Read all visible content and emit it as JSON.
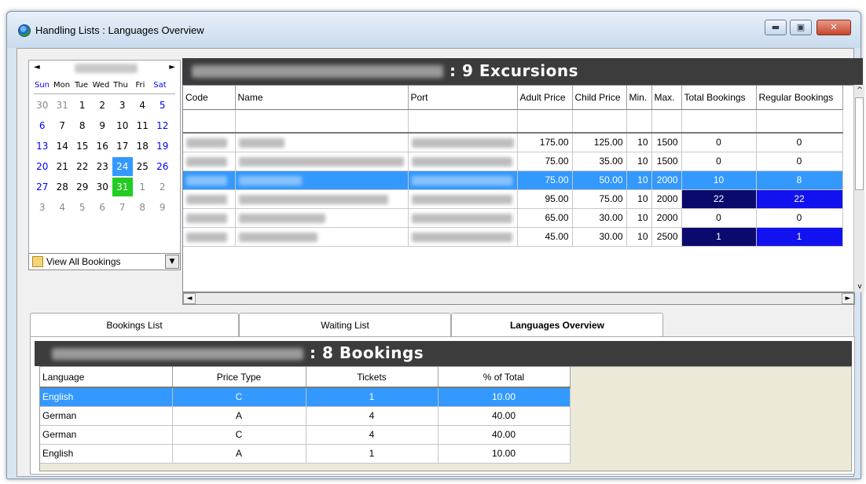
{
  "window": {
    "title": "Handling Lists : Languages Overview",
    "min_symbol": "▬",
    "max_symbol": "▣",
    "close_symbol": "✕"
  },
  "calendar": {
    "prev_symbol": "◄",
    "next_symbol": "►",
    "days_of_week": [
      "Sun",
      "Mon",
      "Tue",
      "Wed",
      "Thu",
      "Fri",
      "Sat"
    ],
    "weeks": [
      [
        {
          "d": "30",
          "k": "other"
        },
        {
          "d": "31",
          "k": "other"
        },
        {
          "d": "1",
          "k": ""
        },
        {
          "d": "2",
          "k": ""
        },
        {
          "d": "3",
          "k": ""
        },
        {
          "d": "4",
          "k": ""
        },
        {
          "d": "5",
          "k": "weekend"
        }
      ],
      [
        {
          "d": "6",
          "k": "weekend"
        },
        {
          "d": "7",
          "k": ""
        },
        {
          "d": "8",
          "k": ""
        },
        {
          "d": "9",
          "k": ""
        },
        {
          "d": "10",
          "k": ""
        },
        {
          "d": "11",
          "k": ""
        },
        {
          "d": "12",
          "k": "weekend"
        }
      ],
      [
        {
          "d": "13",
          "k": "weekend"
        },
        {
          "d": "14",
          "k": ""
        },
        {
          "d": "15",
          "k": ""
        },
        {
          "d": "16",
          "k": ""
        },
        {
          "d": "17",
          "k": ""
        },
        {
          "d": "18",
          "k": ""
        },
        {
          "d": "19",
          "k": "weekend"
        }
      ],
      [
        {
          "d": "20",
          "k": "weekend"
        },
        {
          "d": "21",
          "k": ""
        },
        {
          "d": "22",
          "k": ""
        },
        {
          "d": "23",
          "k": ""
        },
        {
          "d": "24",
          "k": "sel"
        },
        {
          "d": "25",
          "k": ""
        },
        {
          "d": "26",
          "k": "weekend"
        }
      ],
      [
        {
          "d": "27",
          "k": "weekend"
        },
        {
          "d": "28",
          "k": ""
        },
        {
          "d": "29",
          "k": ""
        },
        {
          "d": "30",
          "k": ""
        },
        {
          "d": "31",
          "k": "today"
        },
        {
          "d": "1",
          "k": "other"
        },
        {
          "d": "2",
          "k": "other"
        }
      ],
      [
        {
          "d": "3",
          "k": "other"
        },
        {
          "d": "4",
          "k": "other"
        },
        {
          "d": "5",
          "k": "other"
        },
        {
          "d": "6",
          "k": "other"
        },
        {
          "d": "7",
          "k": "other"
        },
        {
          "d": "8",
          "k": "other"
        },
        {
          "d": "9",
          "k": "other"
        }
      ]
    ],
    "filter_label": "View All Bookings",
    "drop_symbol": "▼"
  },
  "excursions": {
    "count_label": ": 9 Excursions",
    "columns": [
      "Code",
      "Name",
      "Port",
      "Adult Price",
      "Child Price",
      "Min.",
      "Max.",
      "Total Bookings",
      "Regular Bookings"
    ],
    "rows": [
      {
        "adult": "175.00",
        "child": "125.00",
        "min": "10",
        "max": "1500",
        "total": "0",
        "regular": "0",
        "hl": ""
      },
      {
        "adult": "75.00",
        "child": "35.00",
        "min": "10",
        "max": "1500",
        "total": "0",
        "regular": "0",
        "hl": ""
      },
      {
        "adult": "75.00",
        "child": "50.00",
        "min": "10",
        "max": "2000",
        "total": "10",
        "regular": "8",
        "hl": "sel"
      },
      {
        "adult": "95.00",
        "child": "75.00",
        "min": "10",
        "max": "2000",
        "total": "22",
        "regular": "22",
        "hl": "booked"
      },
      {
        "adult": "65.00",
        "child": "30.00",
        "min": "10",
        "max": "2000",
        "total": "0",
        "regular": "0",
        "hl": ""
      },
      {
        "adult": "45.00",
        "child": "30.00",
        "min": "10",
        "max": "2500",
        "total": "1",
        "regular": "1",
        "hl": "booked"
      }
    ],
    "scroll_up": "^",
    "scroll_down": "v",
    "scroll_left": "◄",
    "scroll_right": "►"
  },
  "tabs": [
    {
      "label": "Bookings List"
    },
    {
      "label": "Waiting List"
    },
    {
      "label": "Languages Overview"
    }
  ],
  "languages": {
    "count_label": ": 8 Bookings",
    "columns": [
      "Language",
      "Price Type",
      "Tickets",
      "% of Total"
    ],
    "rows": [
      {
        "language": "English",
        "price_type": "C",
        "tickets": "1",
        "percent": "10.00",
        "sel": true
      },
      {
        "language": "German",
        "price_type": "A",
        "tickets": "4",
        "percent": "40.00",
        "sel": false
      },
      {
        "language": "German",
        "price_type": "C",
        "tickets": "4",
        "percent": "40.00",
        "sel": false
      },
      {
        "language": "English",
        "price_type": "A",
        "tickets": "1",
        "percent": "10.00",
        "sel": false
      }
    ]
  },
  "colors": {
    "selection": "#3399ff",
    "today": "#22cc22",
    "header_bar": "#3c3c3c",
    "booked_total": "#0a0a6e",
    "booked_regular": "#1212f0"
  }
}
